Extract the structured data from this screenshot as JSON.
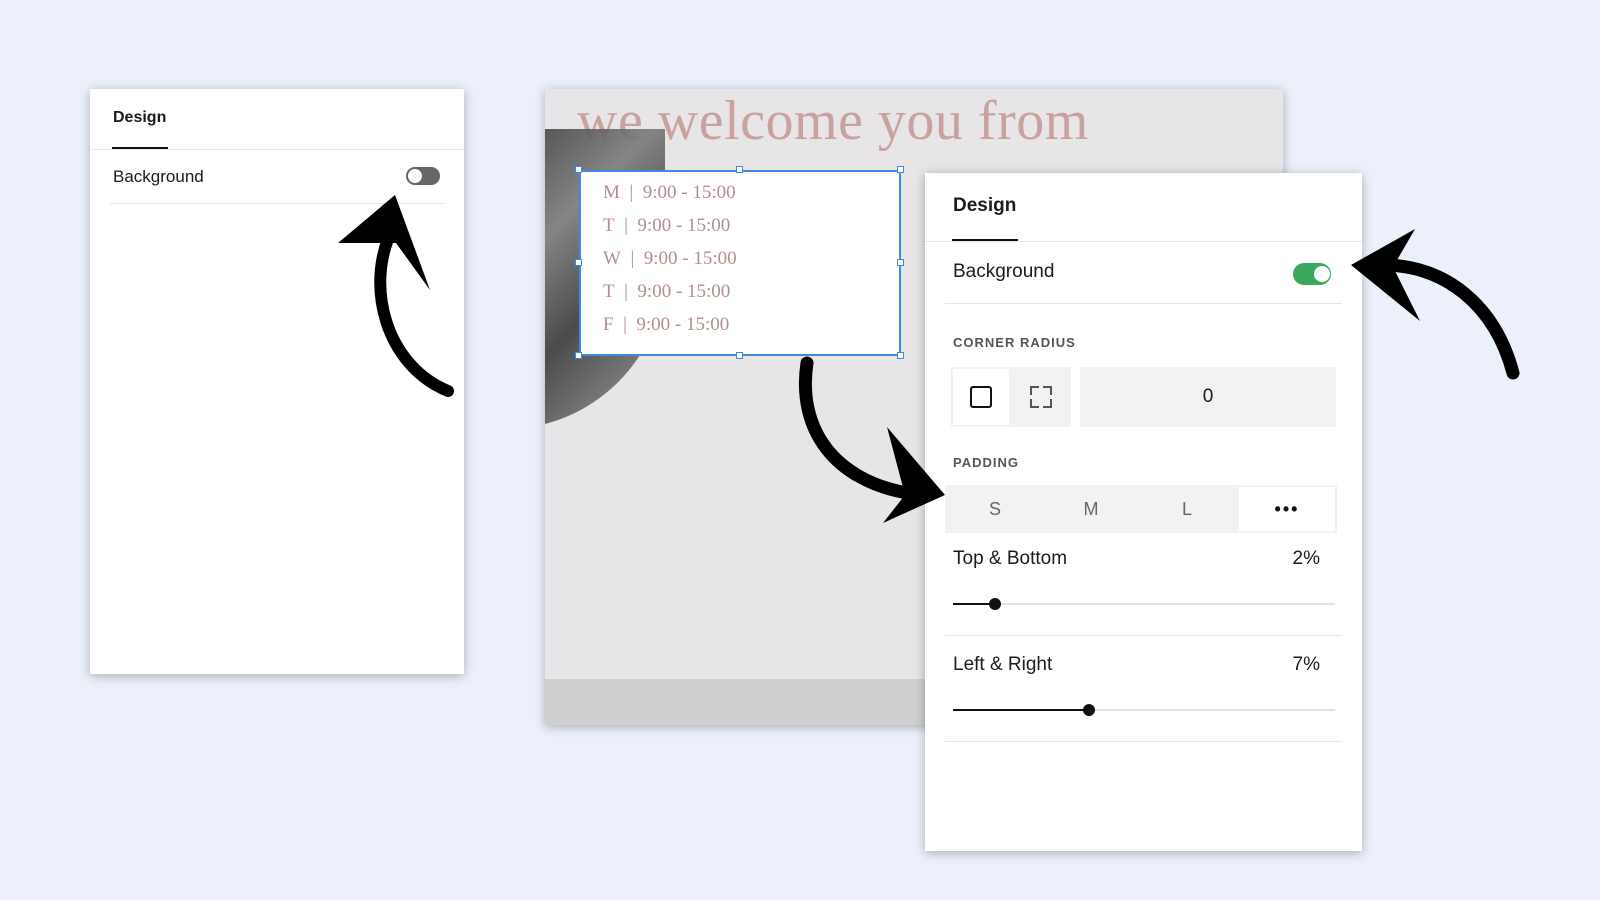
{
  "colors": {
    "page_background": "#ebf0fa",
    "toggle_off": "#666666",
    "toggle_on": "#3aa75d",
    "selection": "#3d8be0",
    "headline": "#c9a19f",
    "hours_text": "#b58e8c"
  },
  "left_panel": {
    "tab": "Design",
    "background_label": "Background",
    "background_enabled": false
  },
  "preview": {
    "headline": "we welcome you from",
    "hours": [
      {
        "day": "M",
        "time": "9:00 - 15:00"
      },
      {
        "day": "T",
        "time": "9:00 - 15:00"
      },
      {
        "day": "W",
        "time": "9:00 - 15:00"
      },
      {
        "day": "T",
        "time": "9:00 - 15:00"
      },
      {
        "day": "F",
        "time": "9:00 - 15:00"
      }
    ]
  },
  "right_panel": {
    "tab": "Design",
    "background_label": "Background",
    "background_enabled": true,
    "corner_radius": {
      "label": "CORNER RADIUS",
      "value": "0",
      "icons": [
        "square-corners-icon",
        "independent-corners-icon"
      ]
    },
    "padding": {
      "label": "PADDING",
      "options": [
        "S",
        "M",
        "L",
        "•••"
      ],
      "selected": "•••",
      "top_bottom": {
        "label": "Top & Bottom",
        "value": "2%",
        "level": 0.11
      },
      "left_right": {
        "label": "Left & Right",
        "value": "7%",
        "level": 0.355
      }
    }
  },
  "annotations": [
    "curved-arrow-icon",
    "curved-arrow-icon",
    "curved-arrow-icon"
  ]
}
